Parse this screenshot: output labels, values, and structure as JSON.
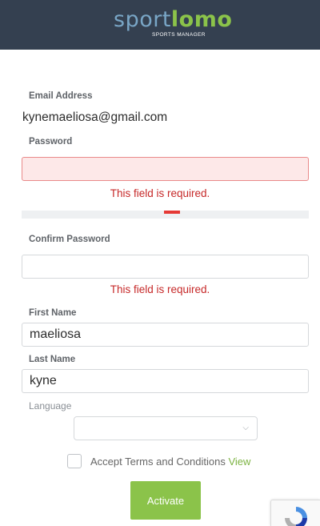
{
  "header": {
    "logo_part1": "sport",
    "logo_part2": "lomo",
    "logo_sub": "SPORTS MANAGER"
  },
  "form": {
    "email": {
      "label": "Email Address",
      "value": "kynemaeliosa@gmail.com"
    },
    "password": {
      "label": "Password",
      "value": "",
      "error": "This field is required.",
      "strength_fraction": 0.06
    },
    "confirm_password": {
      "label": "Confirm Password",
      "value": "",
      "error": "This field is required."
    },
    "first_name": {
      "label": "First Name",
      "value": "maeliosa"
    },
    "last_name": {
      "label": "Last Name",
      "value": "kyne"
    },
    "language": {
      "label": "Language",
      "selected": ""
    },
    "terms": {
      "text": "Accept Terms and Conditions",
      "link": "View",
      "checked": false
    },
    "activate_label": "Activate"
  },
  "colors": {
    "header_bg": "#344050",
    "brand_green": "#8bc34a",
    "error_red": "#c62828",
    "error_field_bg": "#fde8e8"
  }
}
